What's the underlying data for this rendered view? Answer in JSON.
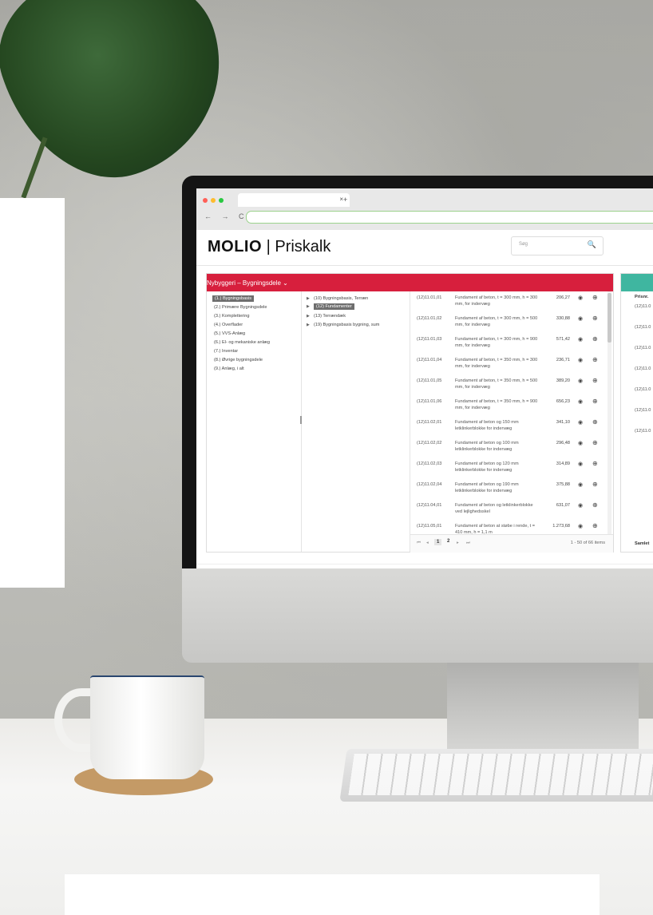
{
  "browser": {
    "nav_glyphs": "← → C",
    "tab_close": "×",
    "new_tab": "+"
  },
  "header": {
    "brand_bold": "MOLIO",
    "brand_sep": " | ",
    "brand_rest": "Priskalk",
    "search_placeholder": "Søg",
    "search_icon": "🔍"
  },
  "panel": {
    "title": "Nybyggeri – Bygningsdele  ⌄",
    "categories": [
      {
        "label": "(1.) Bygningsbasis",
        "selected": true
      },
      {
        "label": "(2.) Primære Bygningsdele"
      },
      {
        "label": "(3.) Komplettering"
      },
      {
        "label": "(4.) Overflader"
      },
      {
        "label": "(5.) VVS-Anlæg"
      },
      {
        "label": "(6.) El- og mekaniske anlæg"
      },
      {
        "label": "(7.) Inventar"
      },
      {
        "label": "(8.) Øvrige bygningsdele"
      },
      {
        "label": "(9.) Anlæg, i alt"
      }
    ],
    "subcategories": [
      {
        "label": "(10) Bygningsbasis, Terræn"
      },
      {
        "label": "(12) Fundamenter",
        "selected": true
      },
      {
        "label": "(13) Terrændæk"
      },
      {
        "label": "(19) Bygningsbasis bygning, sum"
      }
    ],
    "items": [
      {
        "code": "(12)11.01,01",
        "desc": "Fundament af beton, t = 300 mm, h = 300 mm, for indervæg",
        "price": "206,27"
      },
      {
        "code": "(12)11.01,02",
        "desc": "Fundament af beton, t = 300 mm, h = 500 mm, for indervæg",
        "price": "330,88"
      },
      {
        "code": "(12)11.01,03",
        "desc": "Fundament af beton, t = 300 mm, h = 900 mm, for indervæg",
        "price": "571,42"
      },
      {
        "code": "(12)11.01,04",
        "desc": "Fundament af beton, t = 350 mm, h = 300 mm, for indervæg",
        "price": "236,71"
      },
      {
        "code": "(12)11.01,05",
        "desc": "Fundament af beton, t = 350 mm, h = 500 mm, for indervæg",
        "price": "389,20"
      },
      {
        "code": "(12)11.01,06",
        "desc": "Fundament af beton, t = 350 mm, h = 900 mm, for indervæg",
        "price": "656,23"
      },
      {
        "code": "(12)11.02,01",
        "desc": "Fundament af beton og 150 mm letklinkerblokke for indervæg",
        "price": "341,10"
      },
      {
        "code": "(12)11.02,02",
        "desc": "Fundament af beton og 100 mm letklinkerblokke for indervæg",
        "price": "296,48"
      },
      {
        "code": "(12)11.02,03",
        "desc": "Fundament af beton og 120 mm letklinkerblokke for indervæg",
        "price": "314,89"
      },
      {
        "code": "(12)11.02,04",
        "desc": "Fundament af beton og 190 mm letklinkerblokke for indervæg",
        "price": "375,88"
      },
      {
        "code": "(12)11.04,01",
        "desc": "Fundament af beton og letklinkerblokke ved lejlighedsskel",
        "price": "631,07"
      },
      {
        "code": "(12)11.05,01",
        "desc": "Fundament af beton at støbe i rende, t = 410 mm, h = 1,1 m",
        "price": "1.273,68"
      }
    ],
    "eye_icon": "◉",
    "add_icon": "⊕",
    "pager": {
      "first": "⏮",
      "prev": "◂",
      "next": "▸",
      "last": "⏭",
      "pages": [
        "1",
        "2"
      ],
      "current": "1",
      "info": "1 - 50 of 66 items"
    }
  },
  "right_panel": {
    "column": "Prisnr.",
    "items": [
      "(12)11.0",
      "(12)11.0",
      "(12)11.0",
      "(12)11.0",
      "(12)11.0",
      "(12)11.0",
      "(12)11.0"
    ],
    "footer": "Samlet"
  }
}
